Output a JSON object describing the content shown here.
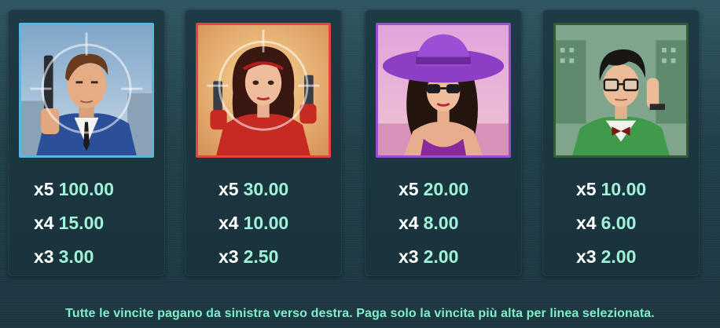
{
  "paytable": {
    "symbols": [
      {
        "icon": "agent-man-icon",
        "frame_color": "#57b8e6",
        "payouts": [
          {
            "count": "x5",
            "value": "100.00"
          },
          {
            "count": "x4",
            "value": "15.00"
          },
          {
            "count": "x3",
            "value": "3.00"
          }
        ]
      },
      {
        "icon": "agent-woman-icon",
        "frame_color": "#e0463f",
        "payouts": [
          {
            "count": "x5",
            "value": "30.00"
          },
          {
            "count": "x4",
            "value": "10.00"
          },
          {
            "count": "x3",
            "value": "2.50"
          }
        ]
      },
      {
        "icon": "lady-hat-icon",
        "frame_color": "#9a4fd0",
        "payouts": [
          {
            "count": "x5",
            "value": "20.00"
          },
          {
            "count": "x4",
            "value": "8.00"
          },
          {
            "count": "x3",
            "value": "2.00"
          }
        ]
      },
      {
        "icon": "hacker-icon",
        "frame_color": "#355a37",
        "payouts": [
          {
            "count": "x5",
            "value": "10.00"
          },
          {
            "count": "x4",
            "value": "6.00"
          },
          {
            "count": "x3",
            "value": "2.00"
          }
        ]
      }
    ]
  },
  "footer": {
    "text": "Tutte le vincite pagano da sinistra verso destra. Paga solo la vincita più alta per linea selezionata."
  },
  "colors": {
    "background": "#213f49",
    "multiplier_text": "#ffffff",
    "value_text": "#9ff2da",
    "footer_text": "#7ef0c8"
  }
}
